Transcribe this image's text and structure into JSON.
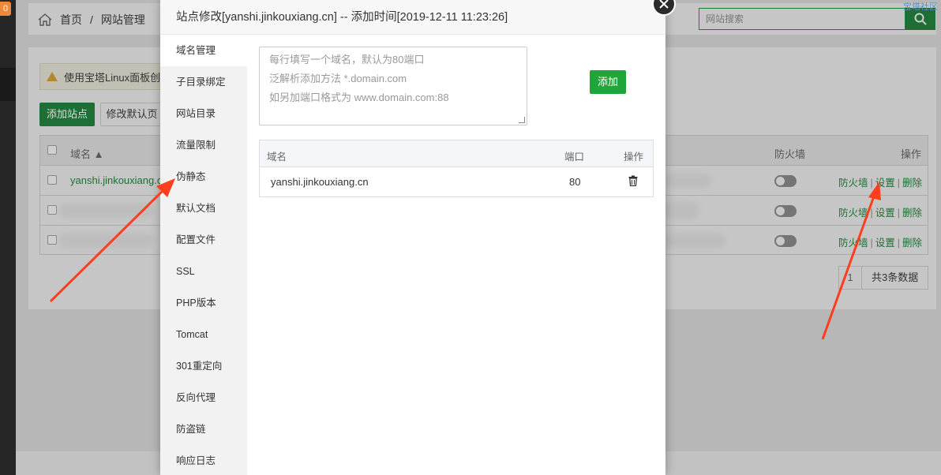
{
  "app": {
    "badge": "0",
    "breadcrumb": {
      "home": "首页",
      "separator": "/",
      "current": "网站管理"
    },
    "search_placeholder": "网站搜索",
    "corner_link": "宝塔社区",
    "alert_text": "使用宝塔Linux面板创",
    "add_site_label": "添加站点",
    "modify_default_label": "修改默认页"
  },
  "site_table": {
    "headers": {
      "domain": "域名 ▲",
      "firewall": "防火墙",
      "operations": "操作"
    },
    "rows": [
      {
        "domain": "yanshi.jinkouxiang.c",
        "firewall_on": false,
        "ops": [
          "防火墙",
          "设置",
          "删除"
        ]
      },
      {
        "domain": "",
        "firewall_on": false,
        "ops": [
          "防火墙",
          "设置",
          "删除"
        ]
      },
      {
        "domain": "",
        "firewall_on": false,
        "ops": [
          "防火墙",
          "设置",
          "删除"
        ]
      }
    ],
    "pager": {
      "page": "1",
      "total": "共3条数据"
    }
  },
  "modal": {
    "title": "站点修改[yanshi.jinkouxiang.cn] -- 添加时间[2019-12-11 11:23:26]",
    "sidebar": [
      "域名管理",
      "子目录绑定",
      "网站目录",
      "流量限制",
      "伪静态",
      "默认文档",
      "配置文件",
      "SSL",
      "PHP版本",
      "Tomcat",
      "301重定向",
      "反向代理",
      "防盗链",
      "响应日志"
    ],
    "active_index": 0,
    "textarea_placeholder_lines": [
      "每行填写一个域名，默认为80端口",
      "泛解析添加方法 *.domain.com",
      "如另加端口格式为 www.domain.com:88"
    ],
    "add_button": "添加",
    "domain_table": {
      "headers": {
        "domain": "域名",
        "port": "端口",
        "action": "操作"
      },
      "rows": [
        {
          "domain": "yanshi.jinkouxiang.cn",
          "port": "80"
        }
      ]
    }
  },
  "colors": {
    "accent": "#20a53a",
    "arrow": "#ff3d1f"
  }
}
